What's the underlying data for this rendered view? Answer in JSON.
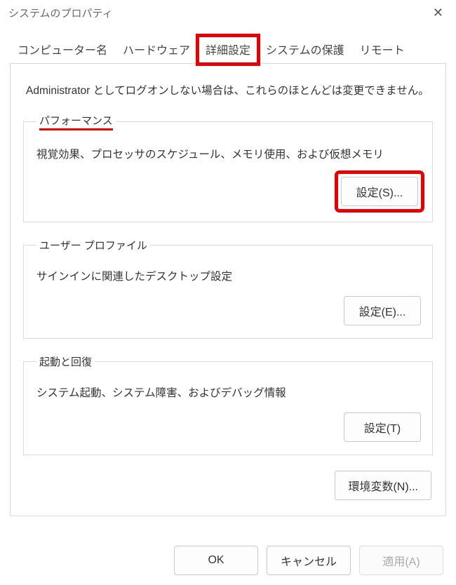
{
  "window": {
    "title": "システムのプロパティ"
  },
  "tabs": {
    "computer_name": "コンピューター名",
    "hardware": "ハードウェア",
    "advanced": "詳細設定",
    "system_protection": "システムの保護",
    "remote": "リモート"
  },
  "admin_note": "Administrator としてログオンしない場合は、これらのほとんどは変更できません。",
  "groups": {
    "performance": {
      "legend": "パフォーマンス",
      "desc": "視覚効果、プロセッサのスケジュール、メモリ使用、および仮想メモリ",
      "button": "設定(S)..."
    },
    "user_profile": {
      "legend": "ユーザー プロファイル",
      "desc": "サインインに関連したデスクトップ設定",
      "button": "設定(E)..."
    },
    "startup_recovery": {
      "legend": "起動と回復",
      "desc": "システム起動、システム障害、およびデバッグ情報",
      "button": "設定(T)"
    }
  },
  "env_button": "環境変数(N)...",
  "footer": {
    "ok": "OK",
    "cancel": "キャンセル",
    "apply": "適用(A)"
  }
}
